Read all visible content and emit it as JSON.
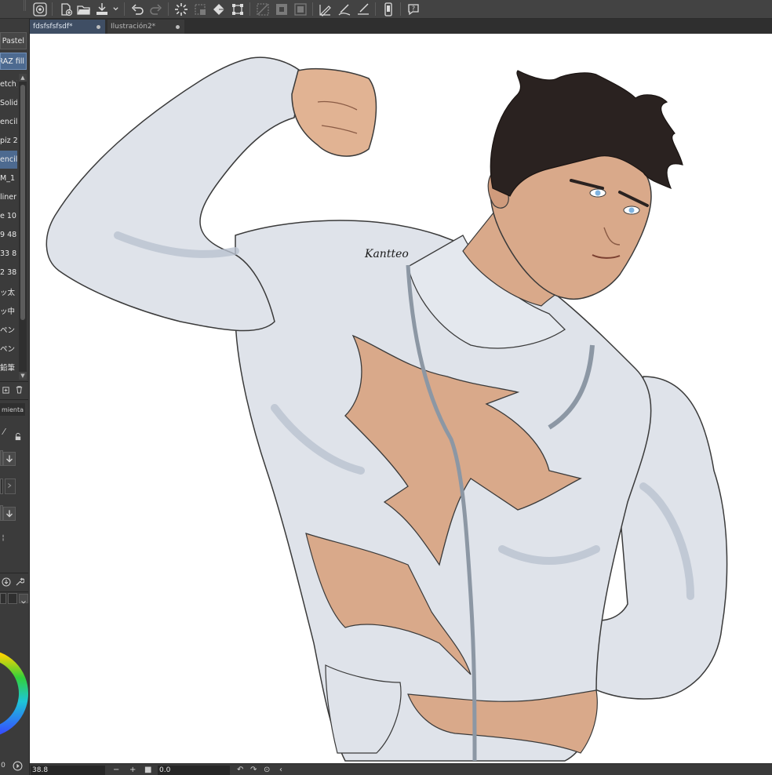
{
  "toolbar": {
    "buttons": [
      {
        "name": "app-logo-icon"
      },
      {
        "name": "new-file-icon"
      },
      {
        "name": "open-folder-icon"
      },
      {
        "name": "save-icon"
      },
      {
        "name": "save-dropdown-chevron-icon"
      },
      {
        "name": "undo-icon"
      },
      {
        "name": "redo-icon"
      },
      {
        "name": "loading-icon"
      },
      {
        "name": "clear-icon"
      },
      {
        "name": "fill-icon"
      },
      {
        "name": "transform-icon"
      },
      {
        "name": "deselect-icon"
      },
      {
        "name": "invert-selection-icon"
      },
      {
        "name": "show-selection-icon"
      },
      {
        "name": "ruler-pen-icon"
      },
      {
        "name": "snap-ruler-icon"
      },
      {
        "name": "snap-special-ruler-icon"
      },
      {
        "name": "smartphone-icon"
      },
      {
        "name": "help-icon"
      }
    ]
  },
  "tabs": [
    {
      "label": "fdsfsfsfsdf*",
      "active": true
    },
    {
      "label": "Ilustración2*",
      "active": false
    }
  ],
  "left_panel": {
    "top_brushes": [
      "Pastel",
      "RAZ fill"
    ],
    "brushes": [
      {
        "label": "etch)",
        "selected": false
      },
      {
        "label": "Solid",
        "selected": false
      },
      {
        "label": "encil",
        "selected": false
      },
      {
        "label": "piz 2",
        "selected": false
      },
      {
        "label": "encil",
        "selected": true
      },
      {
        "label": "M_1",
        "selected": false
      },
      {
        "label": "liner",
        "selected": false
      },
      {
        "label": "e 10",
        "selected": false
      },
      {
        "label": "9 48",
        "selected": false
      },
      {
        "label": "33 8",
        "selected": false
      },
      {
        "label": "2 38",
        "selected": false
      },
      {
        "label": "ッ太",
        "selected": false
      },
      {
        "label": "ッ中",
        "selected": false
      },
      {
        "label": "ペン",
        "selected": false
      },
      {
        "label": "ペン",
        "selected": false
      },
      {
        "label": "鉛筆",
        "selected": false
      }
    ],
    "tool_property_title": "mienta"
  },
  "canvas": {
    "signature": "Kantteo"
  },
  "statusbar": {
    "zoom": "38.8",
    "rotation": "0.0",
    "left_value": "0"
  },
  "colors": {
    "toolbar_bg": "#434343",
    "panel_bg": "#3b3b3b",
    "selected_brush": "#4d6a90",
    "active_tab": "#3f4e64",
    "suit": "#dfe3ea",
    "suit_shadow": "#b9c2cf",
    "skin": "#d9a98a",
    "hair": "#2a2220",
    "eyes": "#7fb3e0"
  }
}
